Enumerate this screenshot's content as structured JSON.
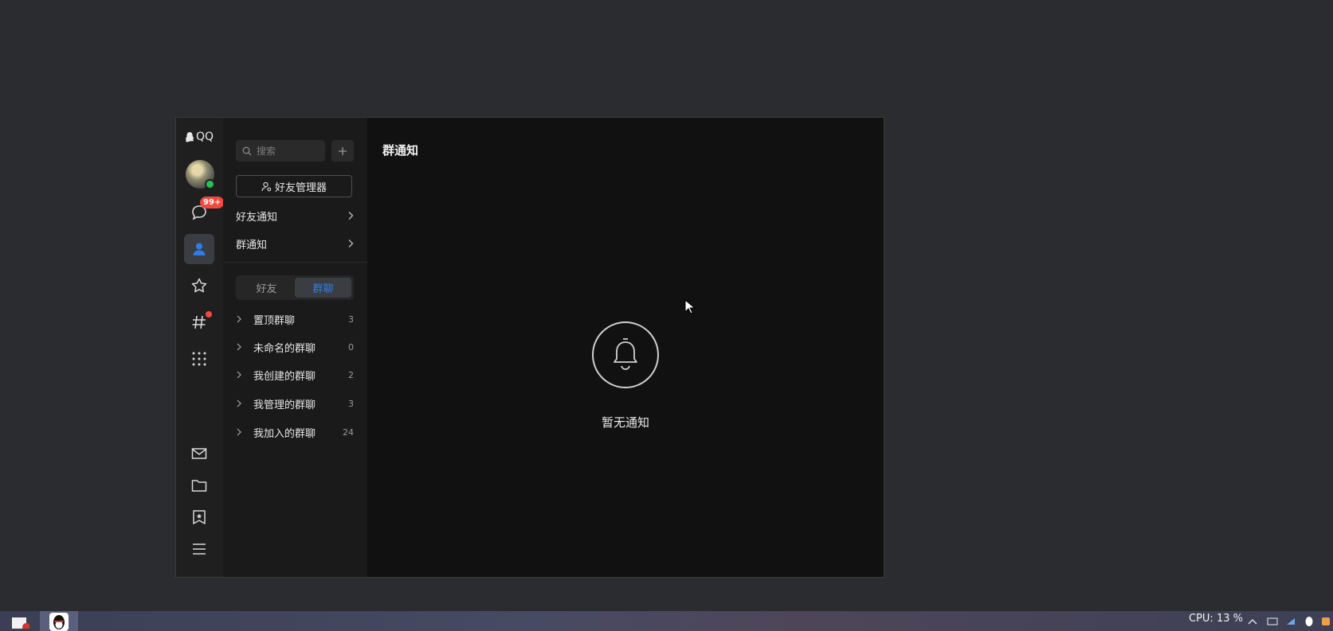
{
  "app": {
    "logo_text": "QQ"
  },
  "rail": {
    "messages_badge": "99+",
    "items": [
      "chat-icon",
      "contacts-icon",
      "star-icon",
      "channel-icon",
      "apps-icon",
      "mail-icon",
      "folder-icon",
      "bookmark-icon",
      "menu-icon"
    ]
  },
  "panel": {
    "search_placeholder": "搜索",
    "friend_manager": "好友管理器",
    "friend_notice": "好友通知",
    "group_notice": "群通知",
    "tabs": [
      "好友",
      "群聊"
    ],
    "active_tab": "群聊",
    "groups": [
      {
        "name": "置顶群聊",
        "count": "3"
      },
      {
        "name": "未命名的群聊",
        "count": "0"
      },
      {
        "name": "我创建的群聊",
        "count": "2"
      },
      {
        "name": "我管理的群聊",
        "count": "3"
      },
      {
        "name": "我加入的群聊",
        "count": "24"
      }
    ]
  },
  "main": {
    "title": "群通知",
    "empty_text": "暂无通知"
  },
  "taskbar": {
    "cpu_text": "CPU: 13 %"
  },
  "colors": {
    "accent": "#2f7ee8",
    "badge": "#f04a3e",
    "online": "#2bbf55"
  }
}
